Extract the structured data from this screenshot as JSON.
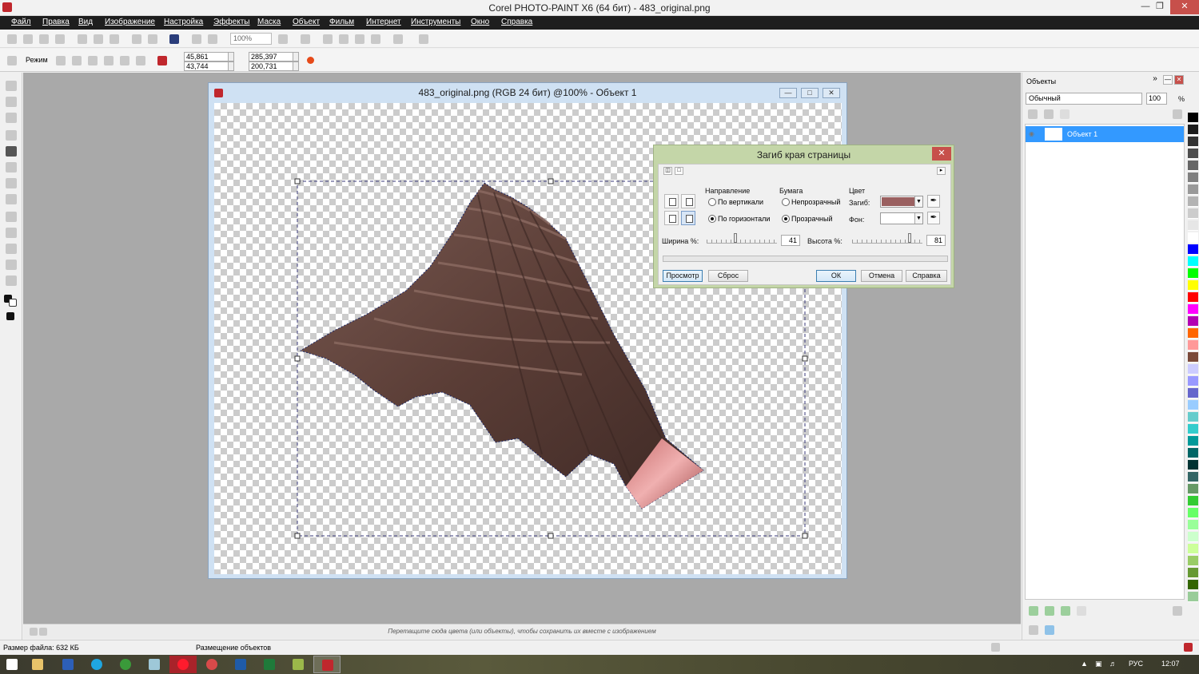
{
  "app": {
    "title": "Corel PHOTO-PAINT X6 (64 бит) - 483_original.png"
  },
  "menu": [
    "Файл",
    "Правка",
    "Вид",
    "Изображение",
    "Настройка",
    "Эффекты",
    "Маска",
    "Объект",
    "Фильм",
    "Интернет",
    "Инструменты",
    "Окно",
    "Справка"
  ],
  "toolbar": {
    "zoom": "100%"
  },
  "property_bar": {
    "mode_label": "Режим",
    "x": "45,861",
    "y": "43,744",
    "width": "285,397",
    "height": "200,731"
  },
  "document": {
    "title": "483_original.png (RGB 24 бит) @100% - Объект 1"
  },
  "dialog": {
    "title": "Загиб края страницы",
    "direction": {
      "label": "Направление",
      "vertical": "По вертикали",
      "horizontal": "По горизонтали",
      "selected": "horizontal"
    },
    "paper": {
      "label": "Бумага",
      "opaque": "Непрозрачный",
      "transparent": "Прозрачный",
      "selected": "transparent"
    },
    "color": {
      "label": "Цвет",
      "curl_label": "Загиб:",
      "background_label": "Фон:",
      "curl_color": "#9a6060",
      "background_color": "#ffffff"
    },
    "width_label": "Ширина %:",
    "width_value": "41",
    "height_label": "Высота %:",
    "height_value": "81",
    "buttons": {
      "preview": "Просмотр",
      "reset": "Сброс",
      "ok": "ОК",
      "cancel": "Отмена",
      "help": "Справка"
    }
  },
  "objects_panel": {
    "title": "Объекты",
    "blend_mode": "Обычный",
    "opacity": "100",
    "opacity_unit": "%",
    "layer_name": "Объект 1"
  },
  "hint": "Перетащите сюда цвета (или объекты), чтобы сохранить их вместе с изображением",
  "status": {
    "file_size": "Размер файла: 632 КБ",
    "info": "Размещение объектов"
  },
  "taskbar": {
    "language": "РУС",
    "time": "12:07"
  },
  "palette_colors": [
    "#000000",
    "#1c1c1c",
    "#333333",
    "#4d4d4d",
    "#666666",
    "#808080",
    "#999999",
    "#b3b3b3",
    "#cccccc",
    "#e6e6e6",
    "#ffffff",
    "#0000ff",
    "#00ffff",
    "#00ff00",
    "#ffff00",
    "#ff0000",
    "#ff00ff",
    "#b300b3",
    "#ff6600",
    "#ff9999",
    "#7a4a3a",
    "#ccccff",
    "#9999ff",
    "#6666cc",
    "#99ccff",
    "#66cccc",
    "#33cccc",
    "#009999",
    "#006666",
    "#003333",
    "#336666",
    "#669966",
    "#33cc33",
    "#66ff66",
    "#99ff99",
    "#ccffcc",
    "#ccff99",
    "#99cc66",
    "#669933",
    "#336600",
    "#99cc99"
  ]
}
